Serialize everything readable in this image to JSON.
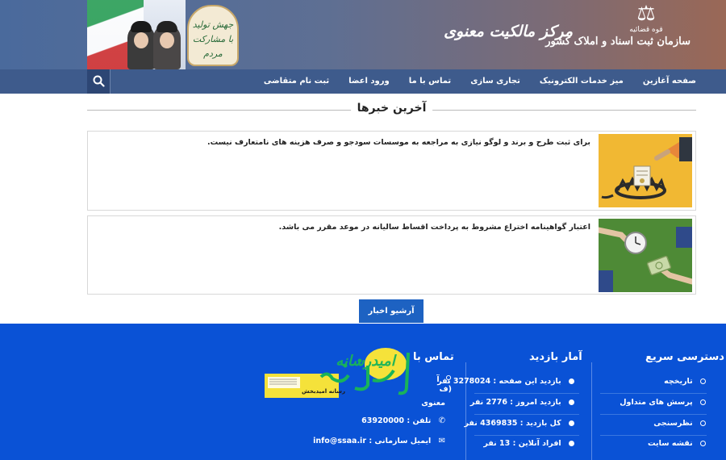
{
  "header": {
    "org_small": "قوه قضائیه",
    "org_name": "سازمان ثبت اسناد و املاک کشور",
    "center_title": "مرکز مالکیت معنوی",
    "slogan_line1": "جهش تولید",
    "slogan_line2": "با مشارکت مردم"
  },
  "nav": {
    "items": [
      "صفحه آغازین",
      "میز خدمات الکترونیک",
      "تجاری سازی",
      "تماس با ما",
      "ورود اعضا",
      "ثبت نام متقاضی"
    ],
    "search_icon": "search-icon"
  },
  "news": {
    "title": "آخرین خبرها",
    "items": [
      {
        "text": "برای ثبت طرح و برند و لوگو نیازی به مراجعه به موسسات سودجو و صرف هزینه های نامتعارف نیست."
      },
      {
        "text": "اعتبار گواهینامه اختراع مشروط به پرداخت اقساط سالیانه در موعد مقرر می باشد."
      }
    ],
    "archive_label": "آرشیو اخبار"
  },
  "footer": {
    "quick_access": {
      "title": "دسترسی سریع",
      "items": [
        "تاریخچه",
        "پرسش های متداول",
        "نظرسنجی",
        "نقشه سایت"
      ]
    },
    "stats": {
      "title": "آمار بازدید",
      "items": [
        "بازدید این صفحه : 3278024 نفر",
        "بازدید امروز : 2776 نفر",
        "کل بازدید : 4369835 نفر",
        "افراد آنلاین : 13 نفر"
      ]
    },
    "contact": {
      "title": "تماس با",
      "address_prefix": "آ",
      "address_line2": "(ف",
      "address_line3": "معنوی",
      "phone": "تلفن : 63920000",
      "email": "ایمیل سازمانی : info@ssaa.ir"
    },
    "overlay_logo": {
      "big_text": "امیدرسانه",
      "caption": "رسانه امیدبخش"
    }
  }
}
